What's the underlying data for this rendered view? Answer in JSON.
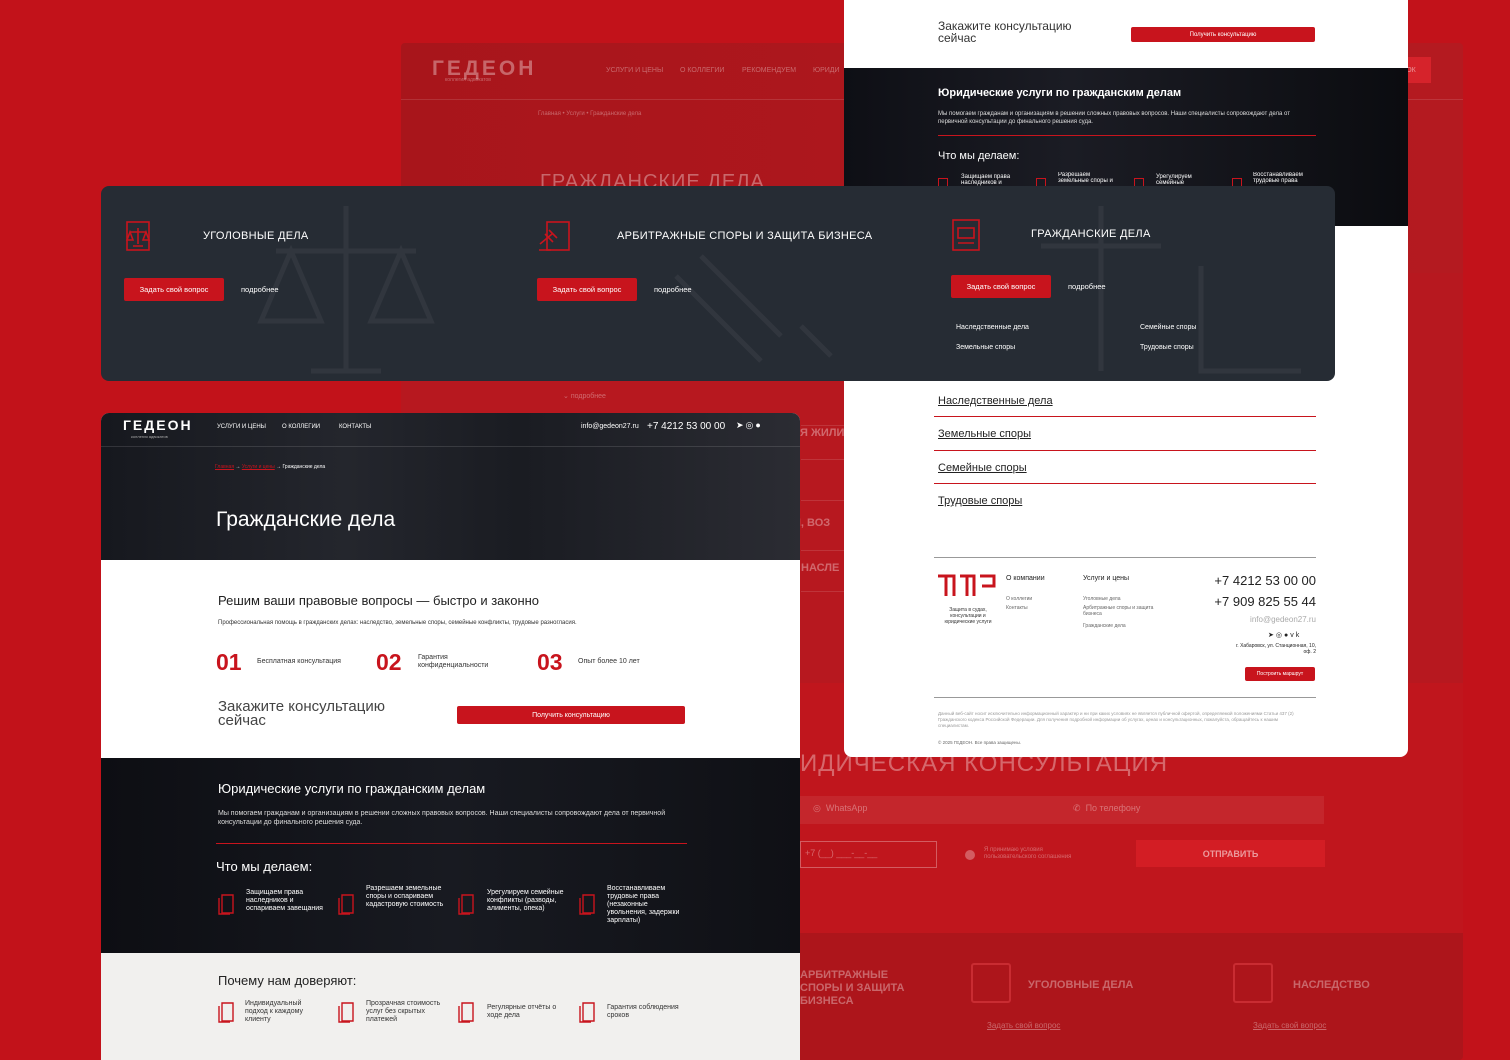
{
  "brand": {
    "name": "ГЕДЕОН",
    "tagline": "коллегия адвокатов"
  },
  "nav": [
    {
      "label": "УСЛУГИ И ЦЕНЫ"
    },
    {
      "label": "О КОЛЛЕГИИ"
    },
    {
      "label": "КОНТАКТЫ"
    }
  ],
  "bg_page": {
    "nav": [
      "УСЛУГИ И ЦЕНЫ",
      "О КОЛЛЕГИИ",
      "РЕКОМЕНДУЕМ",
      "ЮРИДИ"
    ],
    "breadcrumb": [
      "Главная",
      "Услуги",
      "Гражданские дела"
    ],
    "heading": "ГРАЖДАНСКИЕ ДЕЛА",
    "cta_fragment": "ОК",
    "more": "подробнее",
    "rows": [
      "Я ЖИЛИ",
      "И, ВОЗ",
      "НАСЛЕ"
    ],
    "consult_heading": "ИДИЧЕСКАЯ КОНСУЛЬТАЦИЯ",
    "whatsapp": "WhatsApp",
    "phone_opt": "По телефону",
    "phone_mask": "+7 (__) ___-__-__",
    "agree": "Я принимаю условия пользовательского соглашения",
    "send": "ОТПРАВИТЬ",
    "bottom_cards": [
      {
        "title": "АРБИТРАЖНЫЕ СПОРЫ И ЗАЩИТА БИЗНЕСА",
        "link": ""
      },
      {
        "title": "УГОЛОВНЫЕ ДЕЛА",
        "link": "Задать свой вопрос"
      },
      {
        "title": "НАСЛЕДСТВО",
        "link": "Задать свой вопрос"
      }
    ]
  },
  "card_right": {
    "cta_title": "Закажите консультацию сейчас",
    "cta_button": "Получить консультацию",
    "services_title": "Юридические услуги по гражданским делам",
    "services_text": "Мы помогаем гражданам и организациям в решении сложных правовых вопросов. Наши специалисты сопровождают дела от первичной консультации до финального решения суда.",
    "what_title": "Что мы делаем:",
    "what_items": [
      "Защищаем права наследников и",
      "Разрешаем земельные споры и",
      "Урегулируем семейные",
      "Восстанавливаем трудовые права"
    ],
    "links": [
      "Наследственные дела",
      "Земельные споры",
      "Семейные споры",
      "Трудовые споры"
    ],
    "footer": {
      "logo_desc": "Защита в судах, консультации и юридические услуги",
      "col1_title": "О компании",
      "col1_items": [
        "О коллегии",
        "Контакты"
      ],
      "col2_title": "Услуги и цены",
      "col2_items": [
        "Уголовные дела",
        "Арбитражные споры и защита бизнеса",
        "Гражданские дела"
      ],
      "phone1": "+7 4212 53 00 00",
      "phone2": "+7 909 825 55 44",
      "email": "info@gedeon27.ru",
      "address": "г. Хабаровск, ул. Станционная, 10, оф. 2",
      "route_button": "Построить маршрут",
      "disclaimer": "Данный веб-сайт носит исключительно информационный характер и ни при каких условиях не является публичной офертой, определяемой положениями Статьи 437 (2) Гражданского кодекса Российской Федерации. Для получения подробной информации об услугах, ценах и консультационных, пожалуйста, обращайтесь к нашим специалистам.",
      "copyright": "© 2025 ГЕДЕОН. Все права защищены."
    }
  },
  "services": [
    {
      "title": "УГОЛОВНЫЕ ДЕЛА",
      "ask": "Задать свой вопрос",
      "more": "подробнее",
      "sub": []
    },
    {
      "title": "АРБИТРАЖНЫЕ СПОРЫ И ЗАЩИТА БИЗНЕСА",
      "ask": "Задать свой вопрос",
      "more": "подробнее",
      "sub": []
    },
    {
      "title": "ГРАЖДАНСКИЕ ДЕЛА",
      "ask": "Задать свой вопрос",
      "more": "подробнее",
      "sub": [
        "Наследственные дела",
        "Семейные споры",
        "Земельные споры",
        "Трудовые споры"
      ]
    }
  ],
  "card_left": {
    "email": "info@gedeon27.ru",
    "phone": "+7 4212 53 00 00",
    "breadcrumb": [
      "Главная",
      "Услуги и цены",
      "Гражданские дела"
    ],
    "title": "Гражданские дела",
    "lead_title": "Решим ваши правовые вопросы — быстро и законно",
    "lead_text": "Профессиональная помощь в гражданских делах: наследство, земельные споры, семейные конфликты, трудовые разногласия.",
    "stats": [
      {
        "num": "01",
        "label": "Бесплатная консультация"
      },
      {
        "num": "02",
        "label": "Гарантия конфиденциальности"
      },
      {
        "num": "03",
        "label": "Опыт более 10 лет"
      }
    ],
    "cta_title": "Закажите консультацию сейчас",
    "cta_button": "Получить консультацию",
    "services_title": "Юридические услуги по гражданским делам",
    "services_text": "Мы помогаем гражданам и организациям в решении сложных правовых вопросов. Наши специалисты сопровождают дела от первичной консультации до финального решения суда.",
    "what_title": "Что мы делаем:",
    "what_items": [
      "Защищаем права наследников и оспариваем завещания",
      "Разрешаем земельные споры и оспариваем кадастровую стоимость",
      "Урегулируем семейные конфликты (разводы, алименты, опека)",
      "Восстанавливаем трудовые права (незаконные увольнения, задержки зарплаты)"
    ],
    "trust_title": "Почему нам доверяют:",
    "trust_items": [
      "Индивидуальный подход к каждому клиенту",
      "Прозрачная стоимость услуг без скрытых платежей",
      "Регулярные отчёты о ходе дела",
      "Гарантия соблюдения сроков"
    ]
  },
  "colors": {
    "accent": "#c8141d",
    "dark": "#262c34",
    "bg": "#c2121a"
  },
  "icons": [
    "telegram-icon",
    "whatsapp-icon",
    "max-icon",
    "vk-icon",
    "document-icon",
    "scales-icon",
    "gavel-icon",
    "chevron-down-icon"
  ]
}
